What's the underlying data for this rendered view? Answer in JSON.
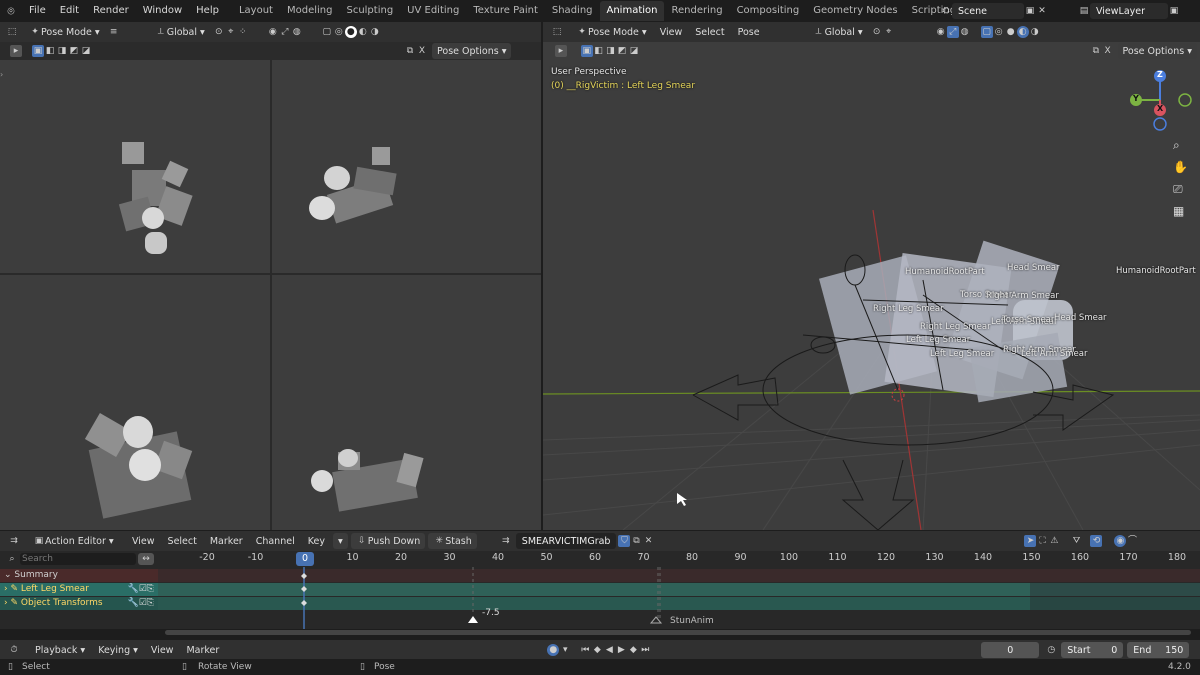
{
  "topbar": {
    "logo": "blender-logo-icon",
    "menus": [
      "File",
      "Edit",
      "Render",
      "Window",
      "Help"
    ],
    "workspaces": [
      "Layout",
      "Modeling",
      "Sculpting",
      "UV Editing",
      "Texture Paint",
      "Shading",
      "Animation",
      "Rendering",
      "Compositing",
      "Geometry Nodes",
      "Scripting"
    ],
    "active_workspace": "Animation",
    "add_tab": "+",
    "scene": "Scene",
    "view_layer": "ViewLayer"
  },
  "left_viewport": {
    "mode": "Pose Mode",
    "orientation": "Global",
    "pose_options": "Pose Options"
  },
  "main_viewport": {
    "mode": "Pose Mode",
    "menus": [
      "View",
      "Select",
      "Pose"
    ],
    "orientation": "Global",
    "pose_options": "Pose Options",
    "view_name": "User Perspective",
    "context_info": "(0) __RigVictim : Left Leg Smear",
    "axis_x": "X",
    "axis_y": "Y",
    "axis_z": "Z",
    "bone_labels": [
      {
        "text": "HumanoidRootPart"
      },
      {
        "text": "Head Smear"
      },
      {
        "text": "HumanoidRootPart"
      },
      {
        "text": "Torso Smear"
      },
      {
        "text": "Right Arm Smear"
      },
      {
        "text": "Right Leg Smear"
      },
      {
        "text": "Left Arm Smear"
      },
      {
        "text": "Torso Smear"
      },
      {
        "text": "Head Smear"
      },
      {
        "text": "Right Leg Smear"
      },
      {
        "text": "Left Leg Smear"
      },
      {
        "text": "Left Leg Smear"
      },
      {
        "text": "Right Arm Smear"
      },
      {
        "text": "Left Arm Smear"
      }
    ]
  },
  "action_editor": {
    "editor_mode": "Action Editor",
    "menus": [
      "View",
      "Select",
      "Marker",
      "Channel",
      "Key"
    ],
    "push_down": "Push Down",
    "stash": "Stash",
    "action_name": "SMEARVICTIMGrab",
    "search_placeholder": "Search",
    "current_frame_badge": "0",
    "ticks": [
      "-20",
      "-10",
      "0",
      "10",
      "20",
      "30",
      "40",
      "50",
      "60",
      "70",
      "80",
      "90",
      "100",
      "110",
      "120",
      "130",
      "140",
      "150",
      "160",
      "170",
      "180"
    ],
    "channels": [
      {
        "name": "Summary"
      },
      {
        "name": "Left Leg Smear"
      },
      {
        "name": "Object Transforms"
      }
    ],
    "markers": [
      {
        "label": "-7.5"
      },
      {
        "label": "StunAnim"
      }
    ]
  },
  "timeline_footer": {
    "menus": [
      "Playback",
      "Keying",
      "View",
      "Marker"
    ],
    "current_frame": "0",
    "start_label": "Start",
    "start_value": "0",
    "end_label": "End",
    "end_value": "150"
  },
  "statusbar": {
    "select": "Select",
    "rotate": "Rotate View",
    "pose": "Pose",
    "version": "4.2.0"
  },
  "colors": {
    "accent": "#4772b3",
    "active_channel": "#2a6e66",
    "summary_row": "#4a2a2a",
    "bone_text": "#ffffff",
    "context_text": "#e5d55a"
  }
}
